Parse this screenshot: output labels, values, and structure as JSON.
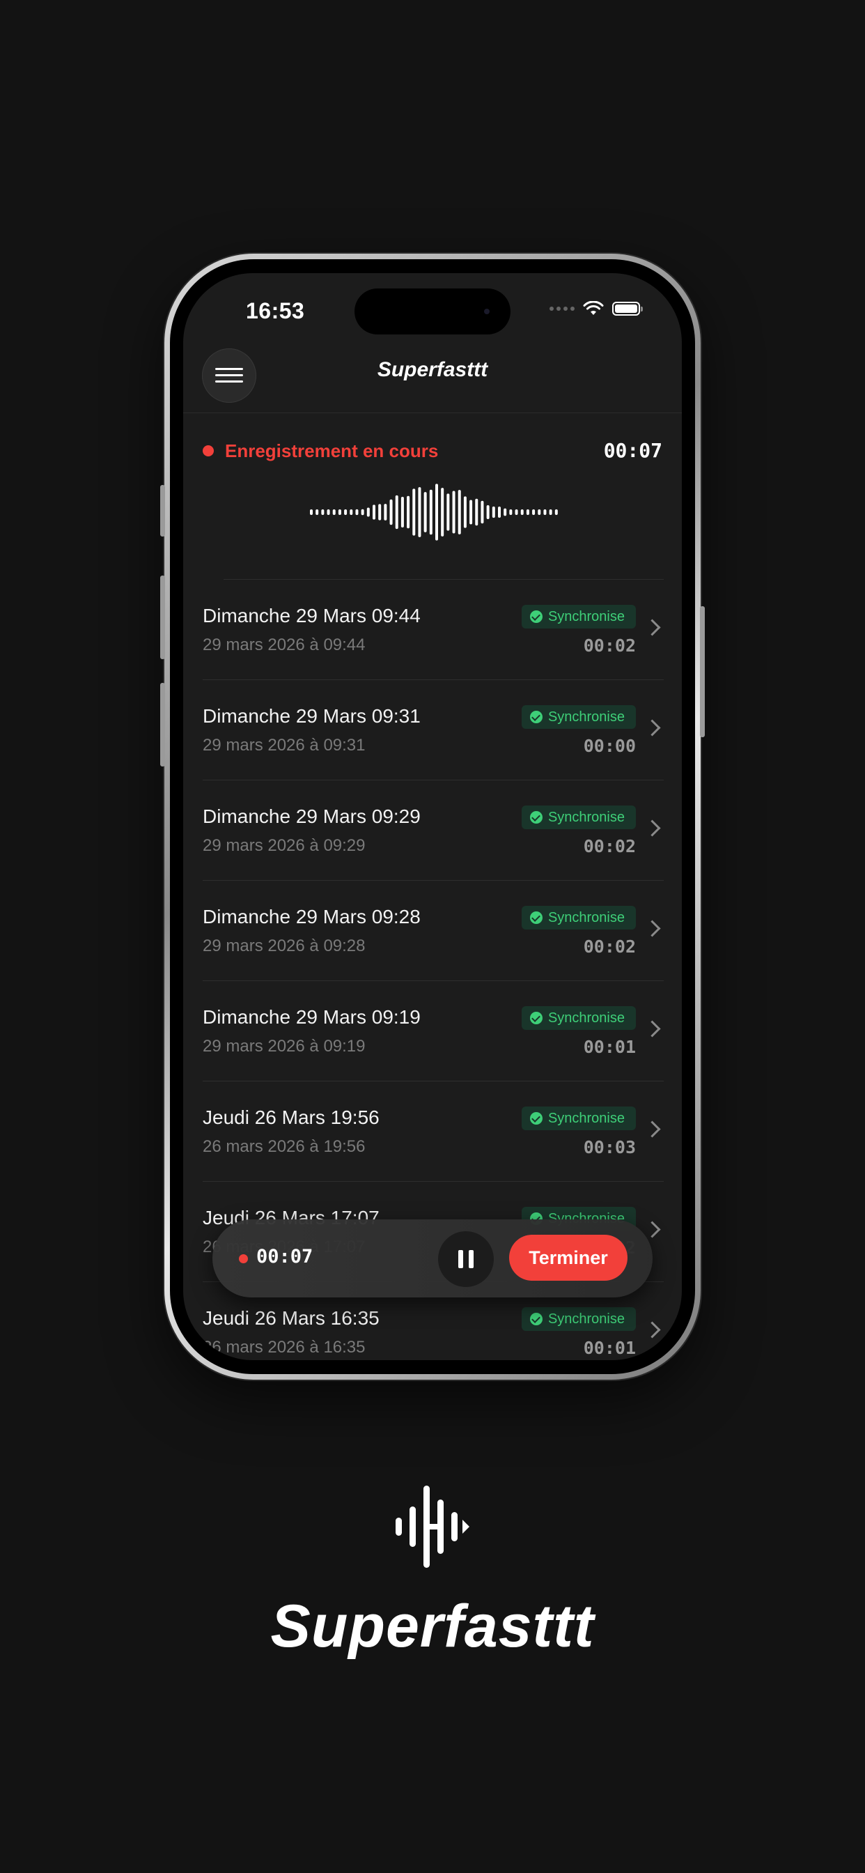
{
  "status_bar": {
    "time": "16:53"
  },
  "header": {
    "title": "Superfasttt",
    "menu_icon": "hamburger-icon"
  },
  "recording": {
    "label": "Enregistrement en cours",
    "elapsed": "00:07",
    "color": "#f2403a"
  },
  "recordings": [
    {
      "title": "Dimanche 29 Mars 09:44",
      "date": "29 mars 2026 à 09:44",
      "status": "Synchronise",
      "duration": "00:02"
    },
    {
      "title": "Dimanche 29 Mars 09:31",
      "date": "29 mars 2026 à 09:31",
      "status": "Synchronise",
      "duration": "00:00"
    },
    {
      "title": "Dimanche 29 Mars 09:29",
      "date": "29 mars 2026 à 09:29",
      "status": "Synchronise",
      "duration": "00:02"
    },
    {
      "title": "Dimanche 29 Mars 09:28",
      "date": "29 mars 2026 à 09:28",
      "status": "Synchronise",
      "duration": "00:02"
    },
    {
      "title": "Dimanche 29 Mars 09:19",
      "date": "29 mars 2026 à 09:19",
      "status": "Synchronise",
      "duration": "00:01"
    },
    {
      "title": "Jeudi 26 Mars 19:56",
      "date": "26 mars 2026 à 19:56",
      "status": "Synchronise",
      "duration": "00:03"
    },
    {
      "title": "Jeudi 26 Mars 17:07",
      "date": "26 mars 2026 à 17:07",
      "status": "Synchronise",
      "duration": "00:02"
    },
    {
      "title": "Jeudi 26 Mars 16:35",
      "date": "26 mars 2026 à 16:35",
      "status": "Synchronise",
      "duration": "00:01"
    }
  ],
  "player": {
    "elapsed": "00:07",
    "end_label": "Terminer",
    "pause_icon": "pause-icon"
  },
  "brand": {
    "name": "Superfasttt",
    "logo_icon": "soundwave-logo-icon"
  },
  "colors": {
    "accent_red": "#f2403a",
    "sync_green": "#3ecf78",
    "background": "#131313"
  }
}
